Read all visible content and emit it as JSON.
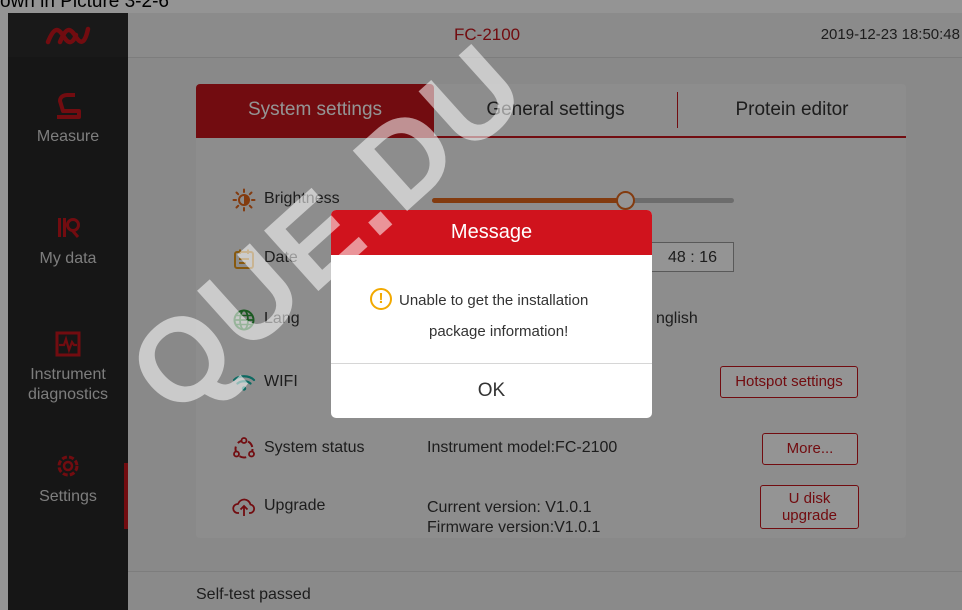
{
  "caption": "own in Picture 3-2-6",
  "sidebar": {
    "items": [
      {
        "label": "Measure",
        "icon": "measure-icon",
        "active": false
      },
      {
        "label": "My data",
        "icon": "my-data-icon",
        "active": false
      },
      {
        "label": "Instrument diagnostics",
        "icon": "diagnostics-icon",
        "active": false
      },
      {
        "label": "Settings",
        "icon": "gear-icon",
        "active": true
      }
    ]
  },
  "header": {
    "model": "FC-2100",
    "datetime": "2019-12-23 18:50:48"
  },
  "tabs": [
    {
      "label": "System settings",
      "active": true
    },
    {
      "label": "General settings",
      "active": false
    },
    {
      "label": "Protein editor",
      "active": false
    }
  ],
  "settings": {
    "brightness": {
      "label": "Brightness",
      "level": 0.64
    },
    "date": {
      "label": "Date",
      "time_value": "48 : 16"
    },
    "language": {
      "label": "Lang",
      "value": "nglish"
    },
    "wifi": {
      "label": "WIFI",
      "hotspot_button": "Hotspot settings"
    },
    "system_status": {
      "label": "System status",
      "value": "Instrument model:FC-2100",
      "more_button": "More..."
    },
    "upgrade": {
      "label": "Upgrade",
      "current_version": "Current version: V1.0.1",
      "firmware_version": "Firmware version:V1.0.1",
      "button": "U disk upgrade"
    }
  },
  "status_bar": {
    "text": "Self-test passed"
  },
  "modal": {
    "title": "Message",
    "line1": "Unable to get the installation",
    "line2": "package information!",
    "ok": "OK"
  },
  "watermark": {
    "text": "QUE.DU"
  },
  "colors": {
    "accent": "#c4161c",
    "sidebar": "#262626",
    "slider": "#e2661b",
    "warning": "#f2a900"
  }
}
